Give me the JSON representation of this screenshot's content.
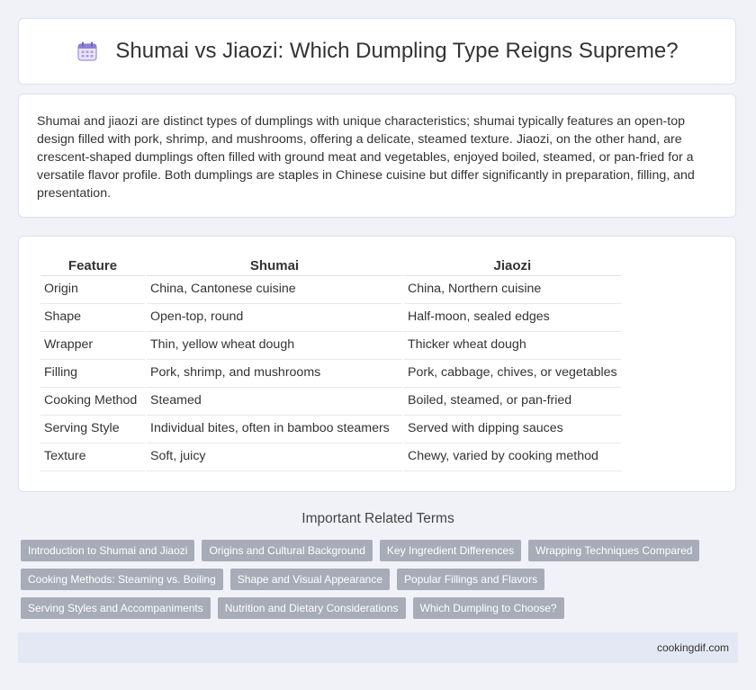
{
  "header": {
    "title": "Shumai vs Jiaozi: Which Dumpling Type Reigns Supreme?",
    "icon": "calendar-icon"
  },
  "intro": {
    "text": "Shumai and jiaozi are distinct types of dumplings with unique characteristics; shumai typically features an open-top design filled with pork, shrimp, and mushrooms, offering a delicate, steamed texture. Jiaozi, on the other hand, are crescent-shaped dumplings often filled with ground meat and vegetables, enjoyed boiled, steamed, or pan-fried for a versatile flavor profile. Both dumplings are staples in Chinese cuisine but differ significantly in preparation, filling, and presentation."
  },
  "table": {
    "headers": [
      "Feature",
      "Shumai",
      "Jiaozi"
    ],
    "rows": [
      [
        "Origin",
        "China, Cantonese cuisine",
        "China, Northern cuisine"
      ],
      [
        "Shape",
        "Open-top, round",
        "Half-moon, sealed edges"
      ],
      [
        "Wrapper",
        "Thin, yellow wheat dough",
        "Thicker wheat dough"
      ],
      [
        "Filling",
        "Pork, shrimp, and mushrooms",
        "Pork, cabbage, chives, or vegetables"
      ],
      [
        "Cooking Method",
        "Steamed",
        "Boiled, steamed, or pan-fried"
      ],
      [
        "Serving Style",
        "Individual bites, often in bamboo steamers",
        "Served with dipping sauces"
      ],
      [
        "Texture",
        "Soft, juicy",
        "Chewy, varied by cooking method"
      ]
    ]
  },
  "related": {
    "title": "Important Related Terms",
    "tags": [
      "Introduction to Shumai and Jiaozi",
      "Origins and Cultural Background",
      "Key Ingredient Differences",
      "Wrapping Techniques Compared",
      "Cooking Methods: Steaming vs. Boiling",
      "Shape and Visual Appearance",
      "Popular Fillings and Flavors",
      "Serving Styles and Accompaniments",
      "Nutrition and Dietary Considerations",
      "Which Dumpling to Choose?"
    ]
  },
  "footer": {
    "site": "cookingdif.com"
  }
}
